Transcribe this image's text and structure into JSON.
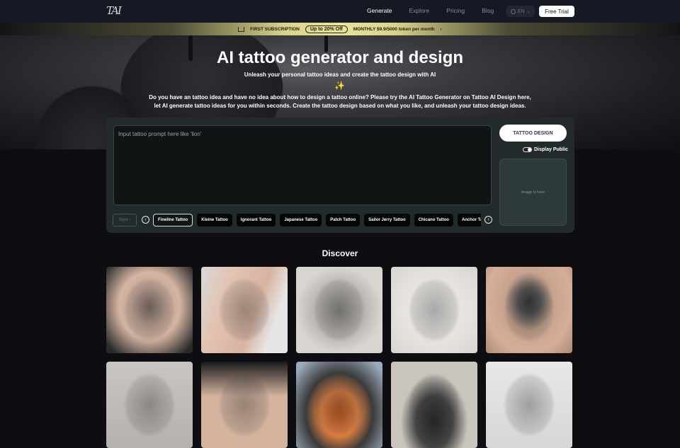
{
  "nav": {
    "logo": "TAI",
    "links": [
      {
        "label": "Generate",
        "active": true
      },
      {
        "label": "Explore",
        "active": false
      },
      {
        "label": "Pricing",
        "active": false
      },
      {
        "label": "Blog",
        "active": false
      }
    ],
    "language": "EN",
    "free_trial_label": "Free Trial"
  },
  "promo": {
    "icon": "crown-icon",
    "label": "FIRST SUBSCRIPTION",
    "badge": "Up to 20% Off",
    "offer": "MONTHLY $9.9/5000 token per month",
    "arrow": "›"
  },
  "hero": {
    "title": "AI tattoo generator and design",
    "subtitle": "Unleash your personal tattoo ideas and create the tattoo design with AI",
    "sparkle": "✨",
    "description_line1": "Do you have an tattoo idea and have no idea about how to design a tattoo online? Please try the AI Tattoo Generator on Tattoo AI Design here,",
    "description_line2": "let AI generate tattoo ideas for you within seconds. Create the tattoo design based on what you like, and unleash your tattoo design ideas."
  },
  "generator": {
    "prompt_placeholder": "Input tattoo prompt here like 'lion'",
    "prompt_value": "",
    "design_button": "TATTOO DESIGN",
    "display_public_label": "Display Public",
    "display_public_on": true,
    "image_placeholder": "Image is here",
    "style_label": "Style ›",
    "prev_icon": "‹",
    "next_icon": "›",
    "styles": [
      {
        "label": "Fineline Tattoo",
        "selected": true
      },
      {
        "label": "Kleine Tattoo",
        "selected": false
      },
      {
        "label": "Ignorant Tattoo",
        "selected": false
      },
      {
        "label": "Japanese Tattoo",
        "selected": false
      },
      {
        "label": "Patch Tattoo",
        "selected": false
      },
      {
        "label": "Sailor Jerry Tattoo",
        "selected": false
      },
      {
        "label": "Chicano Tattoo",
        "selected": false
      },
      {
        "label": "Anchor Tattoo",
        "selected": false
      }
    ]
  },
  "discover": {
    "title": "Discover",
    "images": [
      {
        "alt": "Floral back shoulder tattoo"
      },
      {
        "alt": "Floral thigh tattoo"
      },
      {
        "alt": "Mandala flower sketch"
      },
      {
        "alt": "Woman line art with flowers"
      },
      {
        "alt": "Bull head back tattoo"
      },
      {
        "alt": "Ornamental horned back tattoo"
      },
      {
        "alt": "Geometric leg tattoo"
      },
      {
        "alt": "Colored traditional tattoo"
      },
      {
        "alt": "Japanese style illustration"
      },
      {
        "alt": "Geometric sketch"
      }
    ]
  },
  "colors": {
    "nav_bg": "#161823",
    "page_bg": "#0d0d12",
    "panel_bg": "#222a2c",
    "promo_gold": "#e8e29a",
    "design_button_text": "#3b2f5a"
  }
}
